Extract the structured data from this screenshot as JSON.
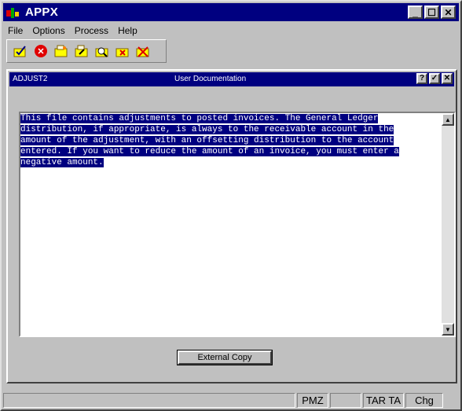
{
  "app": {
    "title": "APPX"
  },
  "menu": {
    "items": [
      "File",
      "Options",
      "Process",
      "Help"
    ]
  },
  "toolbar": {
    "icons": [
      "ok-doc-icon",
      "cancel-icon",
      "add-icon",
      "change-icon",
      "inquire-icon",
      "delete-icon",
      "end-icon"
    ]
  },
  "subwindow": {
    "code": "ADJUST2",
    "title": "User Documentation",
    "buttons": [
      "?",
      "✓",
      "✕"
    ]
  },
  "documentation": {
    "lines": [
      "This file contains adjustments to posted invoices. The General Ledger",
      "distribution, if appropriate, is always to the receivable account in the",
      "amount of the adjustment, with an offsetting distribution to the account",
      "entered. If you want to reduce the amount of an invoice, you must enter a",
      "negative amount."
    ]
  },
  "external_copy_button": {
    "label": "External Copy"
  },
  "statusbar": {
    "cells": [
      "",
      "PMZ",
      "",
      "TAR TA",
      "Chg"
    ]
  }
}
